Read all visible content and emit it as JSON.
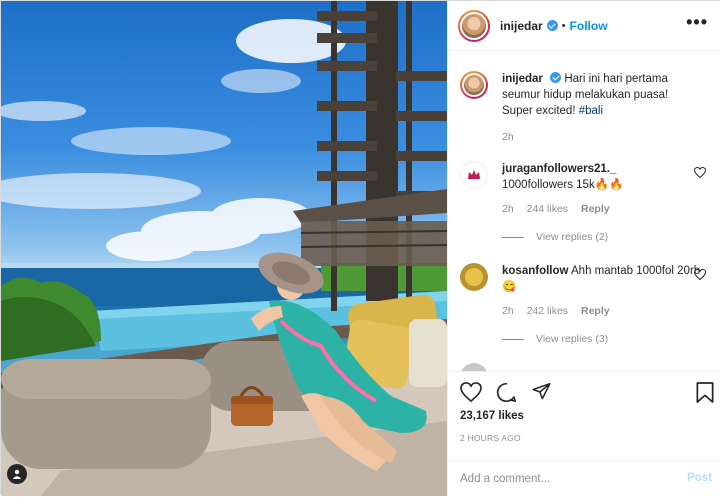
{
  "post": {
    "username": "inijedar",
    "verified_icon": "verified-badge-icon",
    "separator": "•",
    "follow_label": "Follow",
    "more_label": "•••",
    "caption_text": "Hari ini hari pertama seumur hidup melakukan puasa! Super excited! ",
    "caption_hashtag": "#bali",
    "caption_time": "2h"
  },
  "comments": [
    {
      "username": "juraganfollowers21._",
      "text": "1000followers 15k🔥🔥",
      "time": "2h",
      "likes": "244 likes",
      "reply_label": "Reply",
      "view_replies": "View replies (2)"
    },
    {
      "username": "kosanfollow",
      "text": "Ahh mantab 1000fol 20rb😋",
      "time": "2h",
      "likes": "242 likes",
      "reply_label": "Reply",
      "view_replies": "View replies (3)"
    }
  ],
  "actions": {
    "like_icon": "heart-icon",
    "comment_icon": "comment-icon",
    "share_icon": "share-icon",
    "save_icon": "bookmark-icon",
    "likes_count": "23,167 likes",
    "timestamp": "2 HOURS AGO",
    "comment_placeholder": "Add a comment...",
    "post_label": "Post"
  },
  "colors": {
    "accent": "#0095f6",
    "post_disabled": "#b2dffc",
    "muted": "#8e8e8e",
    "text": "#262626"
  }
}
